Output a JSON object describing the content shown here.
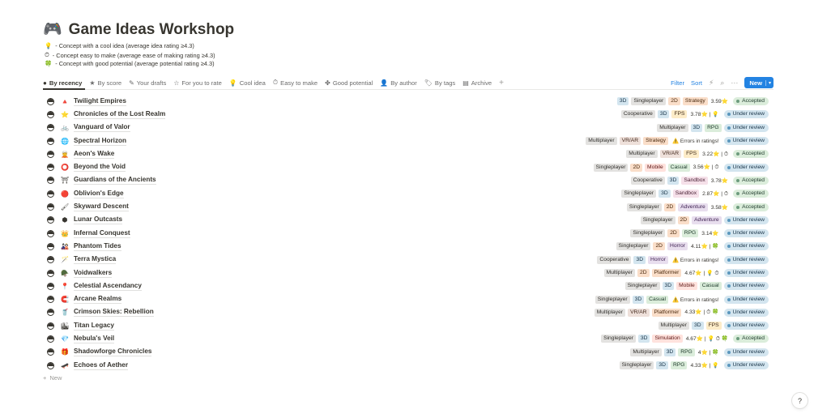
{
  "page": {
    "icon": "🎮",
    "icon_name": "game-controller-icon",
    "title": "Game Ideas Workshop",
    "descriptions": [
      {
        "icon": "💡",
        "text": "- Concept with a cool idea (average idea rating ≥4.3)"
      },
      {
        "icon": "⏱",
        "text": "- Concept easy to make (average ease of making rating ≥4.3)"
      },
      {
        "icon": "🍀",
        "text": "- Concept with good potential (average potential rating ≥4.3)"
      }
    ]
  },
  "tabs": [
    {
      "icon": "●",
      "label": "By recency"
    },
    {
      "icon": "★",
      "label": "By score"
    },
    {
      "icon": "✎",
      "label": "Your drafts"
    },
    {
      "icon": "☆",
      "label": "For you to rate"
    },
    {
      "icon": "💡",
      "label": "Cool idea"
    },
    {
      "icon": "⏱",
      "label": "Easy to make"
    },
    {
      "icon": "✤",
      "label": "Good potential"
    },
    {
      "icon": "👤",
      "label": "By author"
    },
    {
      "icon": "🏷",
      "label": "By tags"
    },
    {
      "icon": "▤",
      "label": "Archive"
    }
  ],
  "toolbar": {
    "add_tab": "+",
    "filter": "Filter",
    "sort": "Sort",
    "lightning": "⚡",
    "search": "⌕",
    "more": "···",
    "new": "New",
    "new_chevron": "▾"
  },
  "tag_colors": {
    "3D": [
      "#d3e5ef",
      "#183347"
    ],
    "2D": [
      "#fadec9",
      "#49290e"
    ],
    "Singleplayer": [
      "#e3e2e0",
      "#32302c"
    ],
    "Multiplayer": [
      "#e3e2e0",
      "#32302c"
    ],
    "Cooperative": [
      "#e3e2e0",
      "#32302c"
    ],
    "Strategy": [
      "#fadec9",
      "#49290e"
    ],
    "FPS": [
      "#fdecc8",
      "#402c1b"
    ],
    "RPG": [
      "#dbeddb",
      "#1c3829"
    ],
    "VR/AR": [
      "#eee0da",
      "#442a1e"
    ],
    "Mobile": [
      "#ffe2dd",
      "#5d1715"
    ],
    "Casual": [
      "#dbeddb",
      "#1c3829"
    ],
    "Sandbox": [
      "#f5e0e9",
      "#4c2337"
    ],
    "Adventure": [
      "#e8deee",
      "#412454"
    ],
    "Horror": [
      "#e8deee",
      "#412454"
    ],
    "Platformer": [
      "#fadec9",
      "#49290e"
    ],
    "Simulation": [
      "#ffe2dd",
      "#5d1715"
    ]
  },
  "status_colors": {
    "Accepted": {
      "bg": "#dbeddb",
      "fg": "#1c3829",
      "dot": "#6c9b7d"
    },
    "Under review": {
      "bg": "#d3e5ef",
      "fg": "#183347",
      "dot": "#5b97bd"
    }
  },
  "rows": [
    {
      "icon": "🔺",
      "name": "Twilight Empires",
      "tags": [
        "3D",
        "Singleplayer",
        "2D",
        "Strategy"
      ],
      "rating": "3.59⭐",
      "status": "Accepted"
    },
    {
      "icon": "⭐",
      "name": "Chronicles of the Lost Realm",
      "tags": [
        "Cooperative",
        "3D",
        "FPS"
      ],
      "rating": "3.78⭐ | 💡",
      "status": "Under review"
    },
    {
      "icon": "🚲",
      "name": "Vanguard of Valor",
      "tags": [
        "Multiplayer",
        "3D",
        "RPG"
      ],
      "rating": "",
      "status": "Under review"
    },
    {
      "icon": "🌐",
      "name": "Spectral Horizon",
      "tags": [
        "Multiplayer",
        "VR/AR",
        "Strategy"
      ],
      "error": "⚠️ Errors in ratings!",
      "status": "Under review"
    },
    {
      "icon": "🧝",
      "name": "Aeon's Wake",
      "tags": [
        "Multiplayer",
        "VR/AR",
        "FPS"
      ],
      "rating": "3.22⭐ | ⏱",
      "status": "Accepted"
    },
    {
      "icon": "⭕",
      "name": "Beyond the Void",
      "tags": [
        "Singleplayer",
        "2D",
        "Mobile",
        "Casual"
      ],
      "rating": "3.56⭐ | ⏱",
      "status": "Under review"
    },
    {
      "icon": "⛩",
      "name": "Guardians of the Ancients",
      "tags": [
        "Cooperative",
        "3D",
        "Sandbox"
      ],
      "rating": "3.78⭐",
      "status": "Accepted"
    },
    {
      "icon": "🔴",
      "name": "Oblivion's Edge",
      "tags": [
        "Singleplayer",
        "3D",
        "Sandbox"
      ],
      "rating": "2.87⭐ | ⏱",
      "status": "Accepted"
    },
    {
      "icon": "🖌",
      "name": "Skyward Descent",
      "tags": [
        "Singleplayer",
        "2D",
        "Adventure"
      ],
      "rating": "3.58⭐",
      "status": "Accepted"
    },
    {
      "icon": "⬢",
      "name": "Lunar Outcasts",
      "tags": [
        "Singleplayer",
        "2D",
        "Adventure"
      ],
      "rating": "",
      "status": "Under review"
    },
    {
      "icon": "👑",
      "name": "Infernal Conquest",
      "tags": [
        "Singleplayer",
        "2D",
        "RPG"
      ],
      "rating": "3.14⭐",
      "status": "Under review"
    },
    {
      "icon": "🎎",
      "name": "Phantom Tides",
      "tags": [
        "Singleplayer",
        "2D",
        "Horror"
      ],
      "rating": "4.11⭐ | 🍀",
      "status": "Under review"
    },
    {
      "icon": "🪄",
      "name": "Terra Mystica",
      "tags": [
        "Cooperative",
        "3D",
        "Horror"
      ],
      "error": "⚠️ Errors in ratings!",
      "status": "Under review"
    },
    {
      "icon": "🪖",
      "name": "Voidwalkers",
      "tags": [
        "Multiplayer",
        "2D",
        "Platformer"
      ],
      "rating": "4.67⭐ | 💡 ⏱",
      "status": "Under review"
    },
    {
      "icon": "📍",
      "name": "Celestial Ascendancy",
      "tags": [
        "Singleplayer",
        "3D",
        "Mobile",
        "Casual"
      ],
      "rating": "",
      "status": "Under review"
    },
    {
      "icon": "🧲",
      "name": "Arcane Realms",
      "tags": [
        "Singleplayer",
        "3D",
        "Casual"
      ],
      "error": "⚠️ Errors in ratings!",
      "status": "Under review"
    },
    {
      "icon": "🥤",
      "name": "Crimson Skies: Rebellion",
      "tags": [
        "Multiplayer",
        "VR/AR",
        "Platformer"
      ],
      "rating": "4.33⭐ | ⏱ 🍀",
      "status": "Under review"
    },
    {
      "icon": "🏙",
      "name": "Titan Legacy",
      "tags": [
        "Multiplayer",
        "3D",
        "FPS"
      ],
      "rating": "",
      "status": "Under review"
    },
    {
      "icon": "💎",
      "name": "Nebula's Veil",
      "tags": [
        "Singleplayer",
        "3D",
        "Simulation"
      ],
      "rating": "4.67⭐ | 💡 ⏱ 🍀",
      "status": "Accepted"
    },
    {
      "icon": "🎁",
      "name": "Shadowforge Chronicles",
      "tags": [
        "Multiplayer",
        "3D",
        "RPG"
      ],
      "rating": "4⭐ | 🍀",
      "status": "Under review"
    },
    {
      "icon": "🛹",
      "name": "Echoes of Aether",
      "tags": [
        "Singleplayer",
        "3D",
        "RPG"
      ],
      "rating": "4.33⭐ | 💡",
      "status": "Under review"
    }
  ],
  "new_row": {
    "icon": "+",
    "label": "New"
  },
  "help": "?"
}
